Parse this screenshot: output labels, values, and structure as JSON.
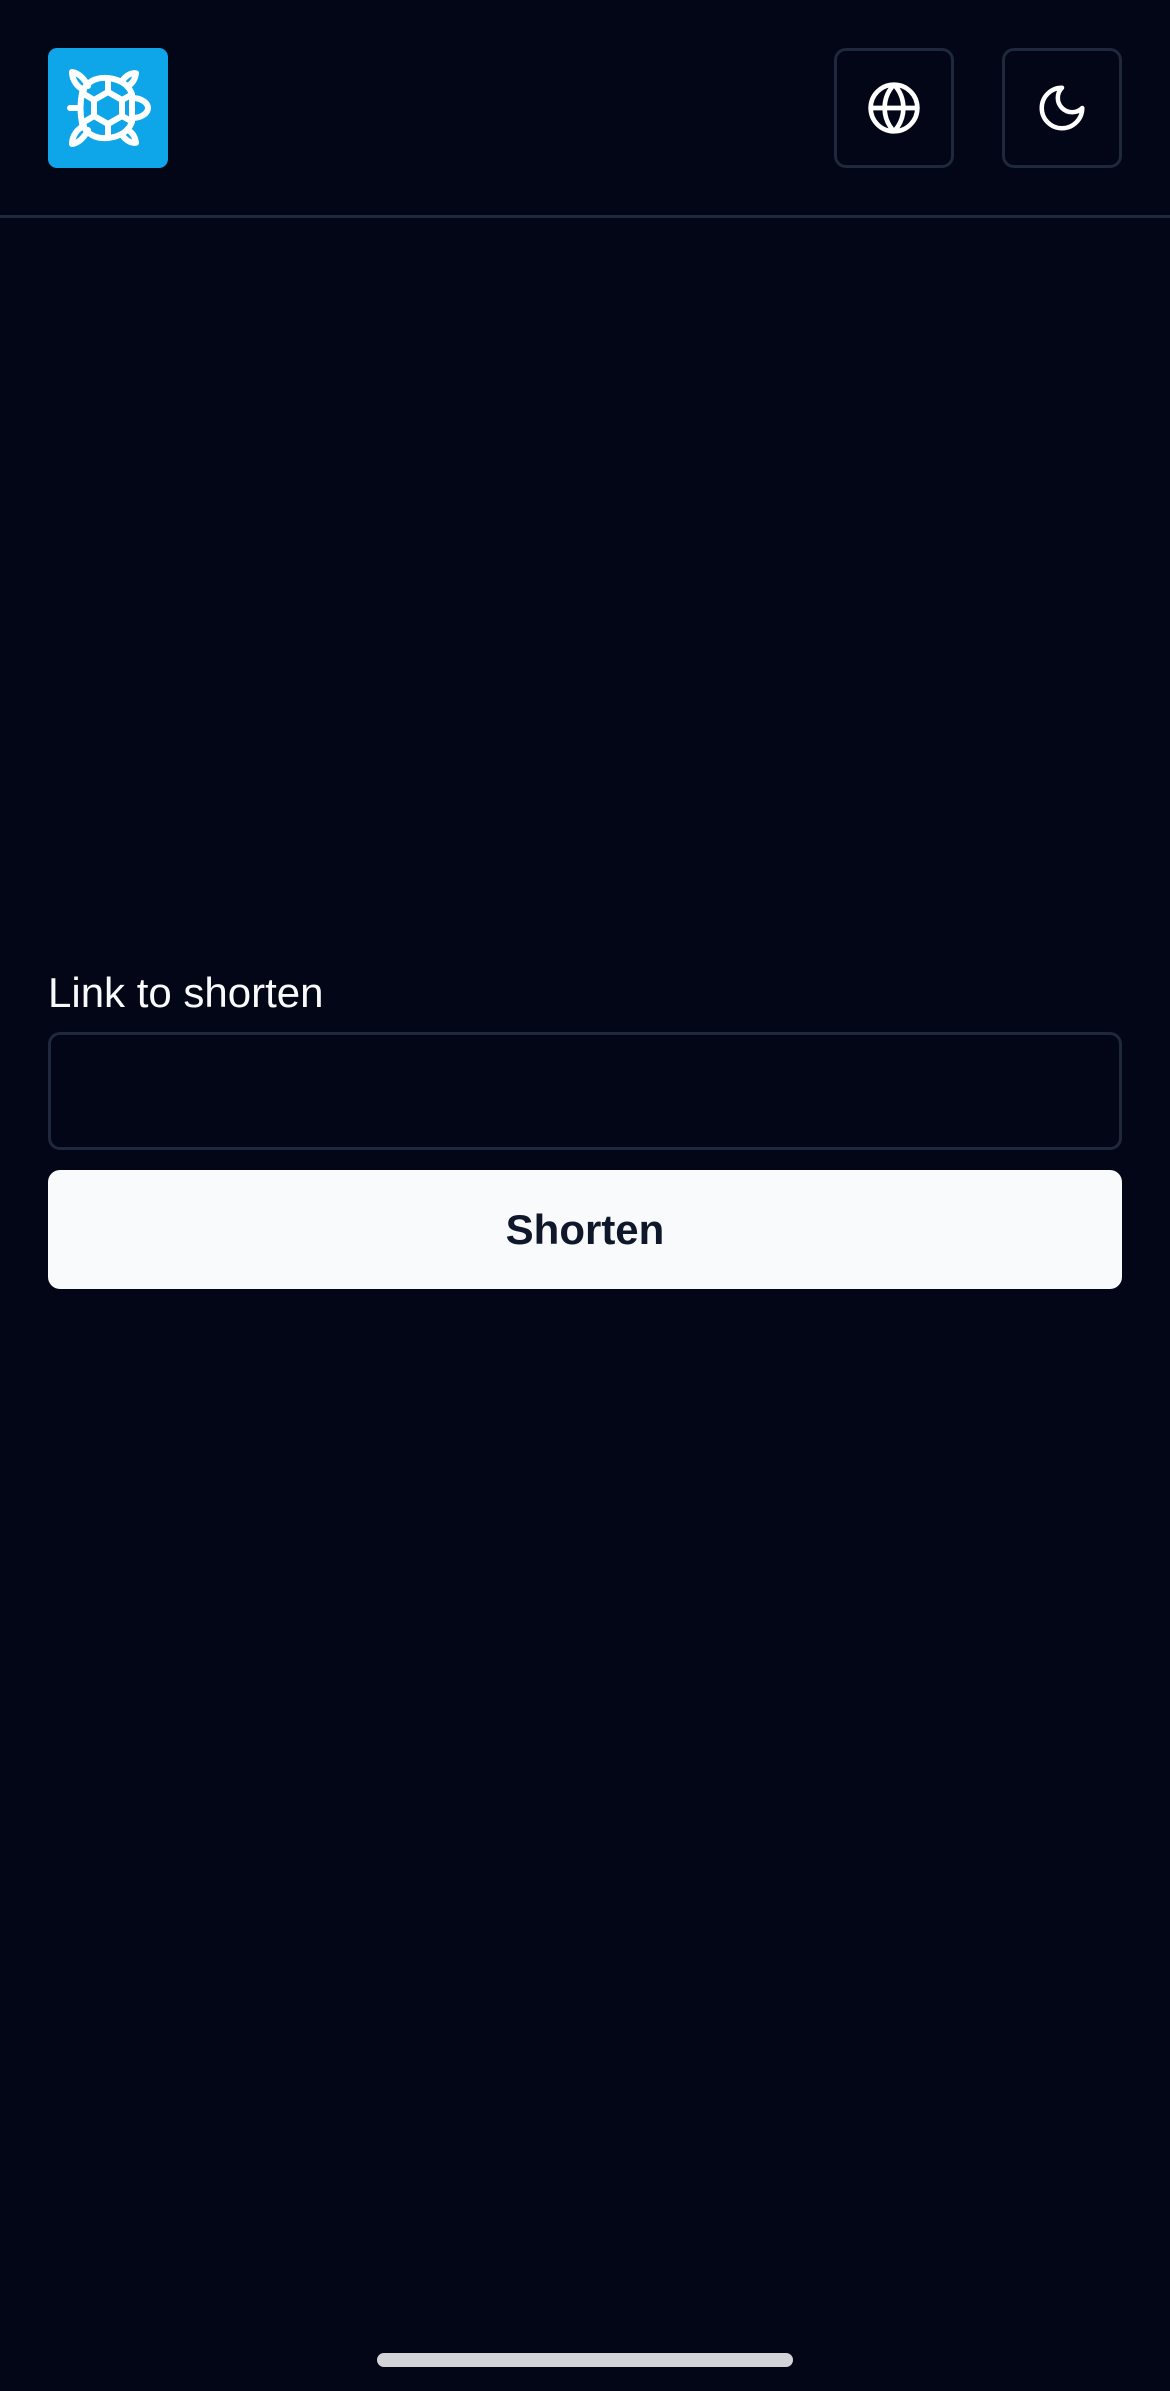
{
  "header": {
    "logo_icon": "turtle-icon",
    "logo_color": "#0ea5e9",
    "language_icon": "globe-icon",
    "theme_icon": "moon-icon"
  },
  "form": {
    "label": "Link to shorten",
    "input_value": "",
    "input_placeholder": "",
    "submit_label": "Shorten"
  },
  "colors": {
    "background": "#020617",
    "border": "#1e293b",
    "button_background": "#f8fafc",
    "button_text": "#0f172a"
  }
}
